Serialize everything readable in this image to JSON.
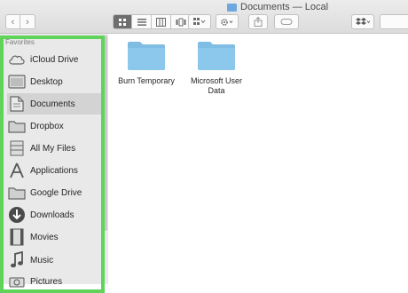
{
  "window": {
    "title": "Documents — Local"
  },
  "toolbar": {
    "back_icon": "chevron-left-icon",
    "forward_icon": "chevron-right-icon",
    "views": [
      "icon-view-icon",
      "list-view-icon",
      "column-view-icon",
      "cover-flow-icon"
    ],
    "arrange_icon": "grid-arrange-icon",
    "action_icon": "gear-icon",
    "share_icon": "share-icon",
    "tags_icon": "tag-icon",
    "dropbox_icon": "dropbox-icon"
  },
  "sidebar": {
    "section": "Favorites",
    "items": [
      {
        "label": "iCloud Drive",
        "icon": "cloud-icon",
        "active": false
      },
      {
        "label": "Desktop",
        "icon": "desktop-icon",
        "active": false
      },
      {
        "label": "Documents",
        "icon": "document-icon",
        "active": true
      },
      {
        "label": "Dropbox",
        "icon": "folder-icon",
        "active": false
      },
      {
        "label": "All My Files",
        "icon": "all-files-icon",
        "active": false
      },
      {
        "label": "Applications",
        "icon": "applications-icon",
        "active": false
      },
      {
        "label": "Google Drive",
        "icon": "folder-icon",
        "active": false
      },
      {
        "label": "Downloads",
        "icon": "download-icon",
        "active": false
      },
      {
        "label": "Movies",
        "icon": "film-icon",
        "active": false
      },
      {
        "label": "Music",
        "icon": "music-icon",
        "active": false
      },
      {
        "label": "Pictures",
        "icon": "camera-icon",
        "active": false
      }
    ]
  },
  "content": {
    "folders": [
      {
        "name": "Burn Temporary"
      },
      {
        "name": "Microsoft User Data"
      }
    ]
  },
  "colors": {
    "highlight": "#5fd35a",
    "folder": "#7fbde4",
    "sidebar_bg": "#e9e9e9"
  }
}
